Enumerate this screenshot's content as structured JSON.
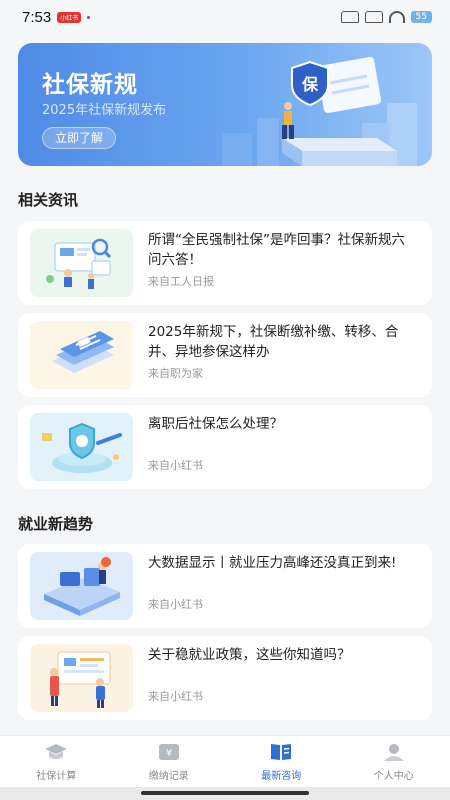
{
  "status_bar": {
    "time": "7:53",
    "notification_badge": "小红书",
    "battery": "55"
  },
  "banner": {
    "title": "社保新规",
    "subtitle": "2025年社保新规发布",
    "button_label": "立即了解",
    "shield_char": "保"
  },
  "sections": {
    "news_title": "相关资讯",
    "trend_title": "就业新趋势"
  },
  "news": [
    {
      "title": "所谓“全民强制社保”是咋回事？社保新规六问六答！",
      "source": "来自工人日报"
    },
    {
      "title": "2025年新规下，社保断缴补缴、转移、合并、异地参保这样办",
      "source": "来自职为家"
    },
    {
      "title": "离职后社保怎么处理？",
      "source": "来自小红书"
    }
  ],
  "trends": [
    {
      "title": "大数据显示丨就业压力高峰还没真正到来!",
      "source": "来自小红书"
    },
    {
      "title": "关于稳就业政策，这些你知道吗？",
      "source": "来自小红书"
    }
  ],
  "tabbar": {
    "items": [
      {
        "label": "社保计算",
        "icon": "graduation-cap-icon"
      },
      {
        "label": "缴纳记录",
        "icon": "yuan-box-icon"
      },
      {
        "label": "最新咨询",
        "icon": "book-icon"
      },
      {
        "label": "个人中心",
        "icon": "user-icon"
      }
    ],
    "active_index": 2
  },
  "colors": {
    "accent": "#2f6fd8",
    "banner_start": "#4f8be6",
    "banner_end": "#9cc7f7"
  }
}
